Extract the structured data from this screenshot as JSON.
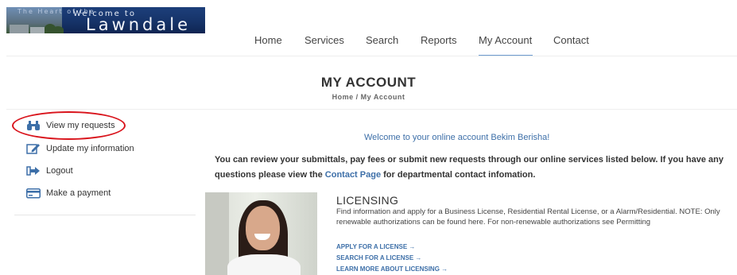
{
  "brand": {
    "header_text": "The Heart of the",
    "welcome_text": "Welcome to",
    "city_name": "Lawndale"
  },
  "nav": {
    "items": [
      {
        "label": "Home"
      },
      {
        "label": "Services"
      },
      {
        "label": "Search"
      },
      {
        "label": "Reports"
      },
      {
        "label": "My Account",
        "active": true
      },
      {
        "label": "Contact"
      }
    ]
  },
  "page": {
    "title": "MY ACCOUNT",
    "breadcrumb": "Home / My Account"
  },
  "sidebar": {
    "items": [
      {
        "label": "View my requests",
        "icon": "binoculars-icon",
        "highlighted": true
      },
      {
        "label": "Update my information",
        "icon": "edit-icon"
      },
      {
        "label": "Logout",
        "icon": "logout-icon"
      },
      {
        "label": "Make a payment",
        "icon": "credit-card-icon"
      }
    ]
  },
  "main": {
    "welcome": "Welcome to your online account Bekim Berisha!",
    "intro_before": "You can review your submittals, pay fees or submit new requests through our online services listed below. If you have any questions please view the ",
    "intro_link": "Contact Page",
    "intro_after": " for departmental contact infomation."
  },
  "licensing": {
    "title": "LICENSING",
    "description": "Find information and apply for a Business License, Residential Rental License, or a Alarm/Residential. NOTE: Only renewable authorizations can be found here. For non-renewable authorizations see Permitting",
    "links": [
      {
        "label": "APPLY FOR A LICENSE →"
      },
      {
        "label": "SEARCH FOR A LICENSE →"
      },
      {
        "label": "LEARN MORE ABOUT LICENSING →"
      }
    ]
  },
  "colors": {
    "link": "#3d6fa8",
    "active_underline": "#6d9bd0",
    "highlight_circle": "#d9141c",
    "icon_blue": "#3d6fa8"
  }
}
